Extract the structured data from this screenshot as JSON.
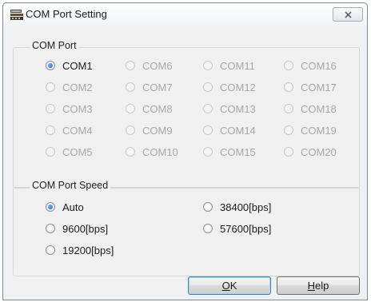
{
  "window": {
    "title": "COM Port Setting"
  },
  "com_port": {
    "label": "COM Port",
    "options": [
      {
        "label": "COM1",
        "checked": true,
        "enabled": true
      },
      {
        "label": "COM2",
        "checked": false,
        "enabled": false
      },
      {
        "label": "COM3",
        "checked": false,
        "enabled": false
      },
      {
        "label": "COM4",
        "checked": false,
        "enabled": false
      },
      {
        "label": "COM5",
        "checked": false,
        "enabled": false
      },
      {
        "label": "COM6",
        "checked": false,
        "enabled": false
      },
      {
        "label": "COM7",
        "checked": false,
        "enabled": false
      },
      {
        "label": "COM8",
        "checked": false,
        "enabled": false
      },
      {
        "label": "COM9",
        "checked": false,
        "enabled": false
      },
      {
        "label": "COM10",
        "checked": false,
        "enabled": false
      },
      {
        "label": "COM11",
        "checked": false,
        "enabled": false
      },
      {
        "label": "COM12",
        "checked": false,
        "enabled": false
      },
      {
        "label": "COM13",
        "checked": false,
        "enabled": false
      },
      {
        "label": "COM14",
        "checked": false,
        "enabled": false
      },
      {
        "label": "COM15",
        "checked": false,
        "enabled": false
      },
      {
        "label": "COM16",
        "checked": false,
        "enabled": false
      },
      {
        "label": "COM17",
        "checked": false,
        "enabled": false
      },
      {
        "label": "COM18",
        "checked": false,
        "enabled": false
      },
      {
        "label": "COM19",
        "checked": false,
        "enabled": false
      },
      {
        "label": "COM20",
        "checked": false,
        "enabled": false
      }
    ]
  },
  "speed": {
    "label": "COM Port Speed",
    "options": [
      {
        "label": "Auto",
        "checked": true
      },
      {
        "label": "9600[bps]",
        "checked": false
      },
      {
        "label": "19200[bps]",
        "checked": false
      },
      {
        "label": "38400[bps]",
        "checked": false
      },
      {
        "label": "57600[bps]",
        "checked": false
      }
    ]
  },
  "buttons": {
    "ok_mnemonic": "O",
    "ok_rest": "K",
    "help_mnemonic": "H",
    "help_rest": "elp"
  },
  "icons": {
    "app": "serial-port-icon",
    "close": "close-icon"
  },
  "colors": {
    "selected_dot": "#1c5fb8",
    "disabled_text": "#a7a7a7",
    "default_button_border": "#3c7fb1"
  }
}
